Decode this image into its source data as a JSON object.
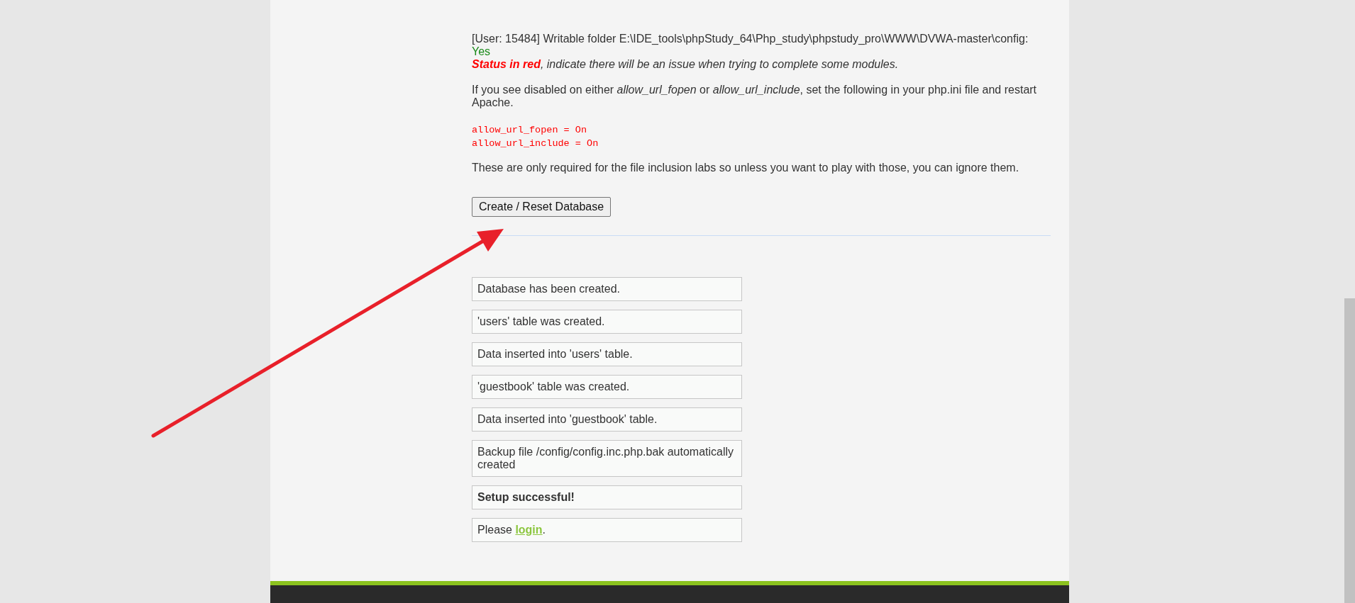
{
  "check": {
    "text": "[User: 15484] Writable folder E:\\IDE_tools\\phpStudy_64\\Php_study\\phpstudy_pro\\WWW\\DVWA-master\\config:",
    "value": "Yes"
  },
  "status_note": "**Status in red**, indicate there will be an issue when trying to complete some modules.",
  "instructions": "If you see disabled on either *allow_url_fopen* or *allow_url_include*, set the following in your php.ini file and restart Apache.",
  "code_lines": [
    "allow_url_fopen = On",
    "allow_url_include = On"
  ],
  "note": "These are only required for the file inclusion labs so unless you want to play with those, you can ignore them.",
  "button": "Create / Reset Database",
  "messages": [
    {
      "kind": "plain",
      "text": "Database has been created."
    },
    {
      "kind": "plain",
      "text": "'users' table was created."
    },
    {
      "kind": "plain",
      "text": "Data inserted into 'users' table."
    },
    {
      "kind": "plain",
      "text": "'guestbook' table was created."
    },
    {
      "kind": "plain",
      "text": "Data inserted into 'guestbook' table."
    },
    {
      "kind": "plain",
      "text": "Backup file /config/config.inc.php.bak automatically created"
    },
    {
      "kind": "bold",
      "text": "Setup successful!"
    },
    {
      "kind": "link",
      "text": "Please ",
      "link": "login",
      "suffix": "."
    }
  ]
}
